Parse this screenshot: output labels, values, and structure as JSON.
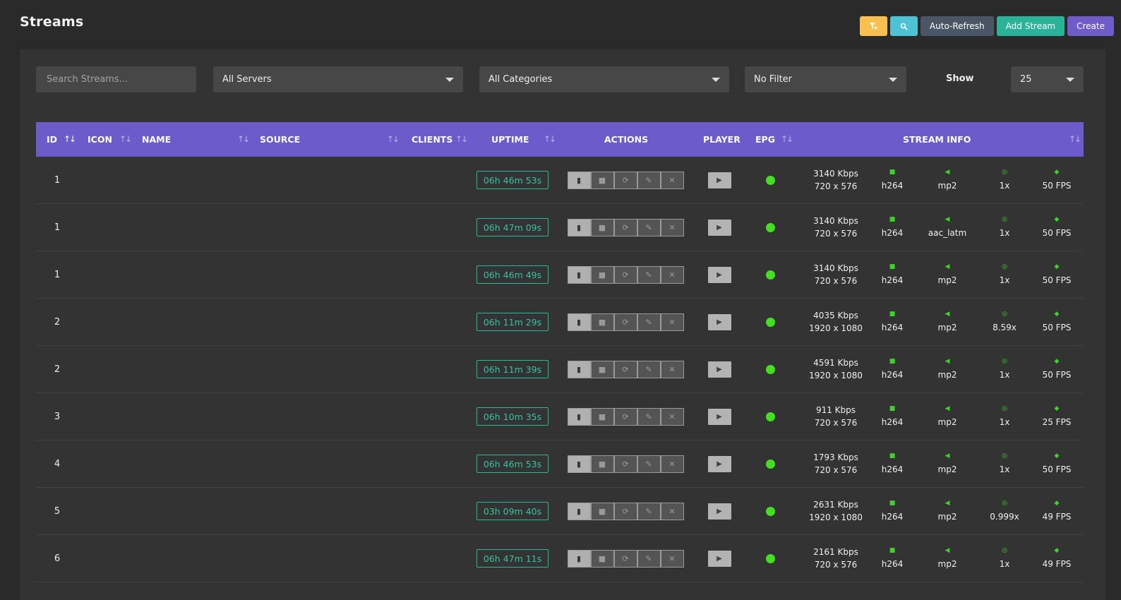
{
  "page": {
    "title": "Streams"
  },
  "toolbar": {
    "filter_icon": "filter-clear-icon",
    "search_icon": "search-icon",
    "auto_refresh": "Auto-Refresh",
    "add_stream": "Add Stream",
    "create": "Create",
    "colors": {
      "filter": "#f8c14f",
      "search": "#4fc3d6",
      "auto": "#4a5565",
      "add": "#2bb39a",
      "create": "#6f5cc8"
    }
  },
  "filters": {
    "search_placeholder": "Search Streams...",
    "servers": "All Servers",
    "categories": "All Categories",
    "filter": "No Filter",
    "show_label": "Show",
    "show_value": "25"
  },
  "table": {
    "header_color": "#6c5ccb",
    "columns": {
      "id": "ID",
      "icon": "ICON",
      "name": "NAME",
      "source": "SOURCE",
      "clients": "CLIENTS",
      "uptime": "UPTIME",
      "actions": "ACTIONS",
      "player": "PLAYER",
      "epg": "EPG",
      "stream_info": "STREAM INFO"
    },
    "action_icons": [
      "file-icon",
      "stop-icon",
      "restart-icon",
      "edit-icon",
      "close-icon"
    ],
    "rows": [
      {
        "id": "1",
        "uptime": "06h 46m 53s",
        "bitrate": "3140 Kbps",
        "resolution": "720 x 576",
        "video": "h264",
        "audio": "mp2",
        "speed": "1x",
        "fps": "50 FPS"
      },
      {
        "id": "1",
        "uptime": "06h 47m 09s",
        "bitrate": "3140 Kbps",
        "resolution": "720 x 576",
        "video": "h264",
        "audio": "aac_latm",
        "speed": "1x",
        "fps": "50 FPS"
      },
      {
        "id": "1",
        "uptime": "06h 46m 49s",
        "bitrate": "3140 Kbps",
        "resolution": "720 x 576",
        "video": "h264",
        "audio": "mp2",
        "speed": "1x",
        "fps": "50 FPS"
      },
      {
        "id": "2",
        "uptime": "06h 11m 29s",
        "bitrate": "4035 Kbps",
        "resolution": "1920 x 1080",
        "video": "h264",
        "audio": "mp2",
        "speed": "8.59x",
        "fps": "50 FPS"
      },
      {
        "id": "2",
        "uptime": "06h 11m 39s",
        "bitrate": "4591 Kbps",
        "resolution": "1920 x 1080",
        "video": "h264",
        "audio": "mp2",
        "speed": "1x",
        "fps": "50 FPS"
      },
      {
        "id": "3",
        "uptime": "06h 10m 35s",
        "bitrate": "911 Kbps",
        "resolution": "720 x 576",
        "video": "h264",
        "audio": "mp2",
        "speed": "1x",
        "fps": "25 FPS"
      },
      {
        "id": "4",
        "uptime": "06h 46m 53s",
        "bitrate": "1793 Kbps",
        "resolution": "720 x 576",
        "video": "h264",
        "audio": "mp2",
        "speed": "1x",
        "fps": "50 FPS"
      },
      {
        "id": "5",
        "uptime": "03h 09m 40s",
        "bitrate": "2631 Kbps",
        "resolution": "1920 x 1080",
        "video": "h264",
        "audio": "mp2",
        "speed": "0.999x",
        "fps": "49 FPS"
      },
      {
        "id": "6",
        "uptime": "06h 47m 11s",
        "bitrate": "2161 Kbps",
        "resolution": "720 x 576",
        "video": "h264",
        "audio": "mp2",
        "speed": "1x",
        "fps": "49 FPS"
      }
    ]
  }
}
